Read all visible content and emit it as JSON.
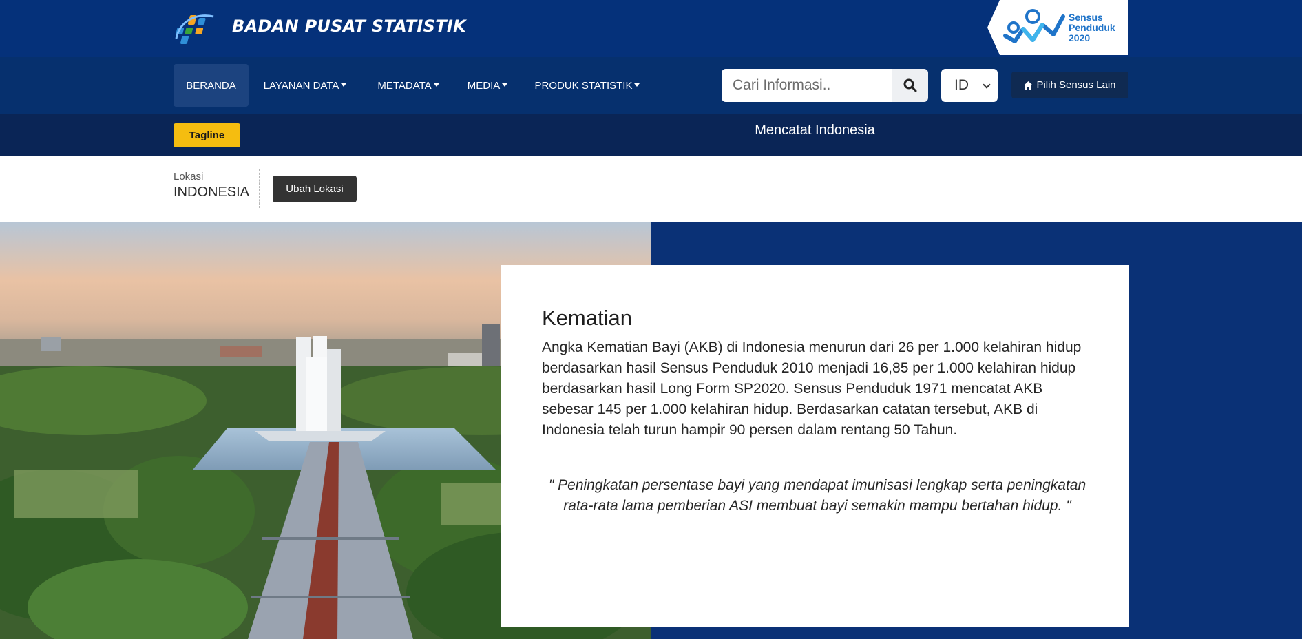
{
  "header": {
    "brand": "BADAN PUSAT STATISTIK",
    "census_badge": [
      "Sensus",
      "Penduduk",
      "2020"
    ]
  },
  "nav": {
    "items": [
      {
        "label": "BERANDA",
        "dropdown": false,
        "active": true
      },
      {
        "label": "LAYANAN DATA",
        "dropdown": true,
        "active": false
      },
      {
        "label": "METADATA",
        "dropdown": true,
        "active": false
      },
      {
        "label": "MEDIA",
        "dropdown": true,
        "active": false
      },
      {
        "label": "PRODUK STATISTIK",
        "dropdown": true,
        "active": false
      }
    ],
    "search_placeholder": "Cari Informasi..",
    "language": "ID",
    "census_button": "Pilih Sensus Lain"
  },
  "tagline": {
    "badge": "Tagline",
    "text": "Mencatat Indonesia"
  },
  "location": {
    "label": "Lokasi",
    "value": "INDONESIA",
    "button": "Ubah Lokasi"
  },
  "card": {
    "title": "Kematian",
    "body": "Angka Kematian Bayi (AKB) di Indonesia menurun dari 26 per 1.000 kelahiran hidup berdasarkan hasil Sensus Penduduk 2010 menjadi 16,85 per 1.000 kelahiran hidup berdasarkan hasil Long Form SP2020. Sensus Penduduk 1971 mencatat AKB sebesar 145 per 1.000 kelahiran hidup. Berdasarkan catatan tersebut, AKB di Indonesia telah turun hampir 90 persen dalam rentang 50 Tahun.",
    "quote": "\" Peningkatan persentase bayi yang mendapat imunisasi lengkap serta peningkatan rata-rata lama pemberian ASI membuat bayi semakin mampu bertahan hidup. \""
  },
  "colors": {
    "header_bg": "#05317a",
    "nav_bg": "#06306e",
    "tagline_bg": "#0a2556",
    "badge_yellow": "#f5bd10",
    "hero_bg": "#0a3176"
  },
  "icons": {
    "logo": "bps-logo",
    "census_logo": "sp2020-logo",
    "search": "search-icon",
    "home": "home-icon"
  }
}
